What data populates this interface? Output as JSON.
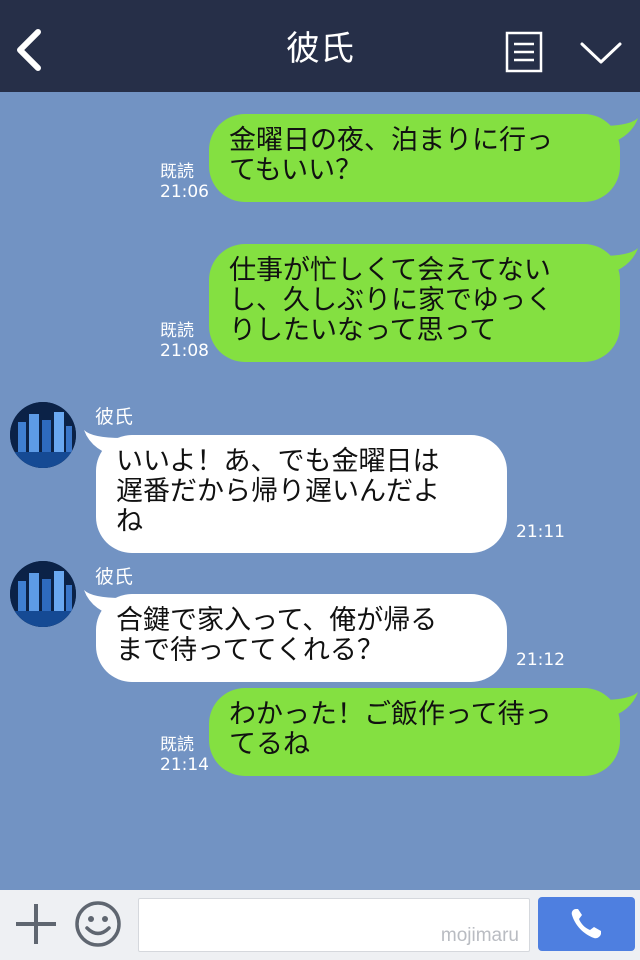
{
  "header": {
    "title": "彼氏",
    "back_icon": "chevron-left-icon",
    "menu_icon": "menu-icon",
    "collapse_icon": "chevron-down-icon",
    "background": "#262f48"
  },
  "messages": [
    {
      "direction": "outgoing",
      "text": "金曜日の夜、泊まりに行っ\nてもいい？",
      "read": "既読",
      "time": "21:06"
    },
    {
      "direction": "outgoing",
      "text": "仕事が忙しくて会えてない\nし、久しぶりに家でゆっく\nりしたいなって思って",
      "read": "既読",
      "time": "21:08"
    },
    {
      "direction": "incoming",
      "sender": "彼氏",
      "text": "いいよ！あ、でも金曜日は\n遅番だから帰り遅いんだよ\nね",
      "time": "21:11"
    },
    {
      "direction": "incoming",
      "sender": "彼氏",
      "text": "合鍵で家入って、俺が帰る\nまで待っててくれる？",
      "time": "21:12"
    },
    {
      "direction": "outgoing",
      "text": "わかった！ご飯作って待っ\nてるね",
      "read": "既読",
      "time": "21:14"
    }
  ],
  "input_bar": {
    "plus_icon": "plus-icon",
    "emoji_icon": "smiley-icon",
    "watermark": "mojimaru",
    "call_icon": "phone-icon"
  },
  "colors": {
    "chat_background": "#7293c3",
    "outgoing_bubble": "#84e041",
    "incoming_bubble": "#ffffff",
    "call_button": "#4e7fe0"
  }
}
